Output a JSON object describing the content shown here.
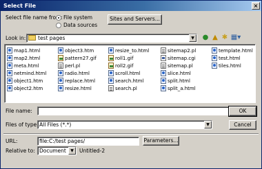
{
  "window": {
    "title": "Select File",
    "close_glyph": "×"
  },
  "source": {
    "label": "Select file name from:",
    "options": [
      "File system",
      "Data sources"
    ],
    "selected": "File system"
  },
  "sites_button": "Sites and Servers...",
  "look_in": {
    "label": "Look in:",
    "value": "test pages"
  },
  "toolbar_icons": [
    "back-icon",
    "up-folder-icon",
    "new-folder-icon",
    "view-menu-icon"
  ],
  "files": {
    "columns": [
      [
        {
          "name": "map1.html",
          "type": "html"
        },
        {
          "name": "map2.html",
          "type": "html"
        },
        {
          "name": "meta.html",
          "type": "html"
        },
        {
          "name": "netmind.html",
          "type": "html"
        },
        {
          "name": "object1.htm",
          "type": "html"
        },
        {
          "name": "object2.htm",
          "type": "html"
        }
      ],
      [
        {
          "name": "object3.htm",
          "type": "html"
        },
        {
          "name": "pattern27.gif",
          "type": "gif"
        },
        {
          "name": "perl.pl",
          "type": "pl"
        },
        {
          "name": "radio.html",
          "type": "html"
        },
        {
          "name": "replace.html",
          "type": "html"
        },
        {
          "name": "resize.html",
          "type": "html"
        }
      ],
      [
        {
          "name": "resize_to.html",
          "type": "html"
        },
        {
          "name": "roll1.gif",
          "type": "gif"
        },
        {
          "name": "roll2.gif",
          "type": "gif"
        },
        {
          "name": "scroll.html",
          "type": "html"
        },
        {
          "name": "search.html",
          "type": "html"
        },
        {
          "name": "search.pl",
          "type": "pl"
        }
      ],
      [
        {
          "name": "sitemap2.pl",
          "type": "pl"
        },
        {
          "name": "sitemap.cgi",
          "type": "cgi"
        },
        {
          "name": "sitemap.pl",
          "type": "pl"
        },
        {
          "name": "slice.html",
          "type": "html"
        },
        {
          "name": "split.html",
          "type": "html"
        },
        {
          "name": "split_a.html",
          "type": "html"
        }
      ],
      [
        {
          "name": "template.html",
          "type": "html"
        },
        {
          "name": "test.html",
          "type": "html"
        },
        {
          "name": "tiles.html",
          "type": "html"
        }
      ]
    ]
  },
  "file_name": {
    "label": "File name:",
    "value": ""
  },
  "ok_button": "OK",
  "files_of_type": {
    "label": "Files of type:",
    "value": "All Files (*.*)"
  },
  "cancel_button": "Cancel",
  "url": {
    "label": "URL:",
    "value": "file:C:/test pages/"
  },
  "parameters_button": "Parameters...",
  "relative_to": {
    "label": "Relative to:",
    "value": "Document",
    "target": "Untitled-2"
  },
  "colors": {
    "titlebar": "#0a246a",
    "face": "#d4d0c8"
  }
}
